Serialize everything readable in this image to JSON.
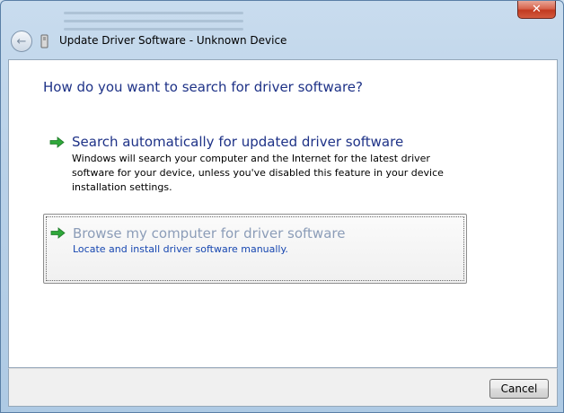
{
  "window": {
    "title": "Update Driver Software - Unknown Device",
    "close_glyph": "✕"
  },
  "nav": {
    "back_glyph": "←"
  },
  "main": {
    "question": "How do you want to search for driver software?",
    "option1": {
      "title": "Search automatically for updated driver software",
      "description": "Windows will search your computer and the Internet for the latest driver software for your device, unless you've disabled this feature in your device installation settings."
    },
    "option2": {
      "title": "Browse my computer for driver software",
      "description": "Locate and install driver software manually."
    }
  },
  "footer": {
    "cancel_label": "Cancel"
  },
  "colors": {
    "heading": "#1e3287",
    "link_hover_desc": "#1646b0",
    "arrow_green": "#2fa83a"
  },
  "icons": [
    "back-arrow-icon",
    "device-icon",
    "close-icon",
    "green-arrow-icon"
  ]
}
